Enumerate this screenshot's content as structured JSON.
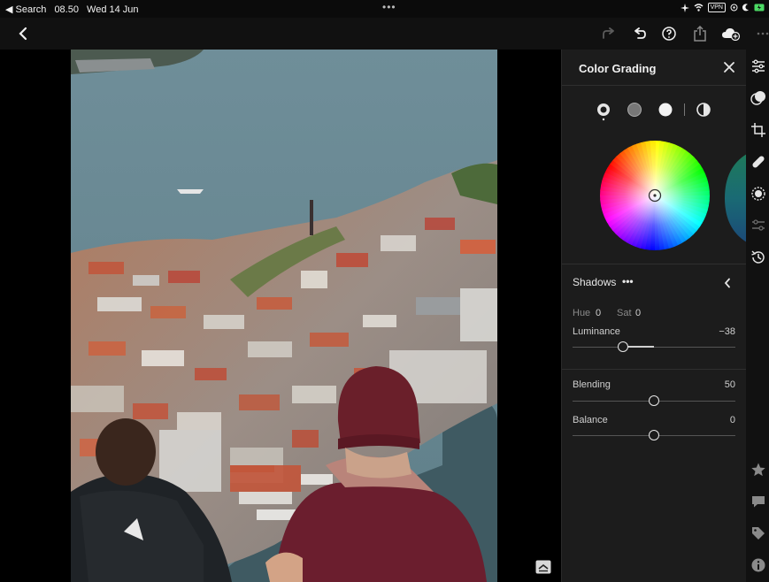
{
  "status_bar": {
    "back_app": "◀ Search",
    "time": "08.50",
    "date": "Wed 14 Jun",
    "dots": "•••",
    "vpn": "VPN"
  },
  "toolbar": {
    "icons": [
      "back-chevron-icon",
      "redo-icon",
      "undo-icon",
      "help-icon",
      "share-icon",
      "cloud-sync-icon",
      "more-icon"
    ]
  },
  "panel": {
    "title": "Color Grading",
    "modes": [
      "shadows-mode",
      "midtones-mode",
      "highlights-mode",
      "global-mode"
    ],
    "selected_mode": "shadows-mode",
    "section": {
      "name": "Shadows",
      "more": "•••"
    },
    "hue_label": "Hue",
    "hue_value": "0",
    "sat_label": "Sat",
    "sat_value": "0",
    "luminance": {
      "label": "Luminance",
      "value": "−38",
      "level": -38,
      "range": [
        -100,
        100
      ]
    },
    "blending": {
      "label": "Blending",
      "value": "50",
      "level": 50,
      "range": [
        0,
        100
      ]
    },
    "balance": {
      "label": "Balance",
      "value": "0",
      "level": 0,
      "range": [
        -100,
        100
      ]
    }
  },
  "toolstrip": {
    "icons": [
      "edit-sliders-icon",
      "masking-icon",
      "crop-icon",
      "healing-icon",
      "selective-icon",
      "presets-icon",
      "history-icon",
      "star-icon",
      "comment-icon",
      "tag-icon",
      "info-icon"
    ]
  },
  "colors": {
    "panel_bg": "#1c1c1c",
    "toolbar_bg": "#111111",
    "accent_text": "#e6e6e6"
  }
}
